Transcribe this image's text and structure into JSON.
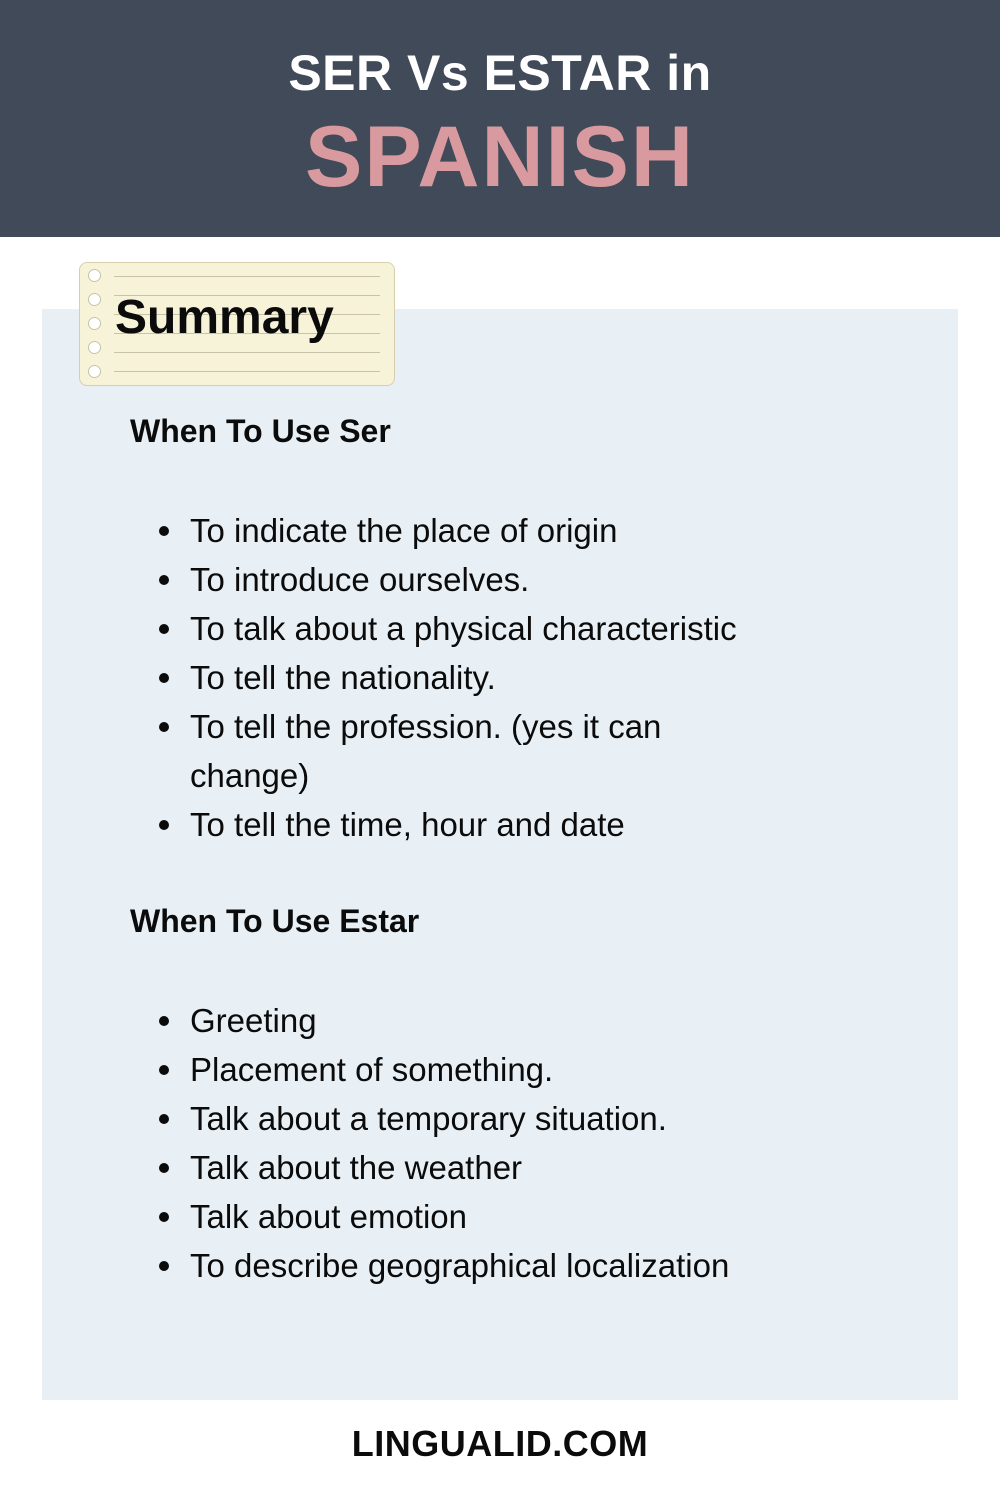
{
  "header": {
    "title_line1": "SER Vs ESTAR in",
    "title_line2": "SPANISH"
  },
  "summary": {
    "label": "Summary",
    "sections": [
      {
        "heading": "When To Use Ser",
        "items": [
          "To indicate the place of origin",
          "To introduce ourselves.",
          "To talk about a physical characteristic",
          "To tell the nationality.",
          "To tell the profession. (yes it can change)",
          "To tell the time, hour and date"
        ]
      },
      {
        "heading": "When To Use Estar",
        "items": [
          "Greeting",
          "Placement of something.",
          "Talk about a temporary situation.",
          "Talk about the weather",
          "Talk about emotion",
          "To describe geographical localization"
        ]
      }
    ]
  },
  "footer": {
    "site": "LINGUALID.COM"
  },
  "colors": {
    "header_bg": "#414a58",
    "title_accent": "#d89a9f",
    "panel_bg": "#e8f0f6",
    "note_bg": "#f7f3d9"
  }
}
